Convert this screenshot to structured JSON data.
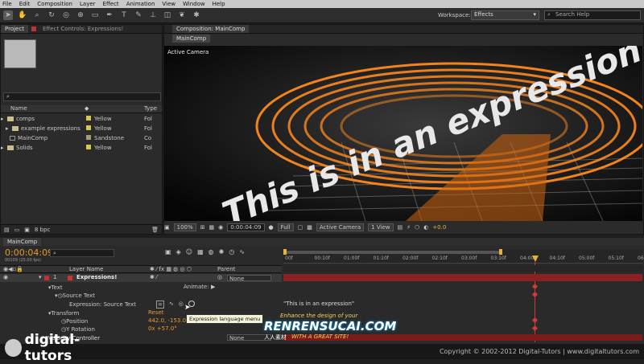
{
  "menu": [
    "File",
    "Edit",
    "Composition",
    "Layer",
    "Effect",
    "Animation",
    "View",
    "Window",
    "Help"
  ],
  "workspace": {
    "label": "Workspace:",
    "value": "Effects"
  },
  "search_help_placeholder": "Search Help",
  "project_panel": {
    "tabs": [
      "Project",
      "Effect Controls: Expressions!"
    ],
    "columns": {
      "name": "Name",
      "type": "Type"
    },
    "items": [
      {
        "name": "comps",
        "label": "Yellow",
        "label_color": "#d8c84a",
        "type": "Fol"
      },
      {
        "name": "example expressions",
        "label": "Yellow",
        "label_color": "#d8c84a",
        "type": "Fol"
      },
      {
        "name": "MainComp",
        "label": "Sandstone",
        "label_color": "#a89a7a",
        "type": "Co"
      },
      {
        "name": "Solids",
        "label": "Yellow",
        "label_color": "#d8c84a",
        "type": "Fol"
      }
    ],
    "bpc": "8 bpc"
  },
  "composition": {
    "tab": "Composition: MainComp",
    "subtab": "MainComp",
    "camera_label": "Active Camera",
    "scene_text": "This is in an expression",
    "zoom": "100%",
    "timecode": "0:00:04:09",
    "resolution": "Full",
    "camera_select": "Active Camera",
    "views": "1 View",
    "exposure": "+0.0"
  },
  "timeline": {
    "tab": "MainComp",
    "timecode": "0:00:04:09",
    "frame_info": "00109 (25.00 fps)",
    "col_layer_name": "Layer Name",
    "col_parent": "Parent",
    "ruler_ticks": [
      "00f",
      "00:10f",
      "01:00f",
      "01:10f",
      "02:00f",
      "02:10f",
      "03:00f",
      "03:10f",
      "04:00f",
      "04:10f",
      "05:00f",
      "05:10f",
      "06:00f"
    ],
    "layer": {
      "number": "1",
      "name": "Expressions!",
      "parent": "None"
    },
    "rows": [
      {
        "label": "Text",
        "indent": 1
      },
      {
        "label": "Source Text",
        "indent": 2
      },
      {
        "label": "Expression: Source Text",
        "indent": 3
      },
      {
        "label": "Transform",
        "indent": 1
      },
      {
        "label": "Position",
        "indent": 2
      },
      {
        "label": "Y Rotation",
        "indent": 2
      },
      {
        "label": "Velocity Controller",
        "indent": 1
      }
    ],
    "animate_label": "Animate:",
    "reset_label": "Reset",
    "position_value": "442.0, -153.0",
    "rotation_value": "0x +57.0°",
    "expression_text": "\"This is in an expression\"",
    "tooltip": "Expression language menu",
    "parent2": "None"
  },
  "watermark": {
    "brand": "digital-tutors",
    "copyright": "Copyright © 2002-2012 Digital-Tutors  |  www.digitaltutors.com",
    "site_tagline": "Enhance the design of your",
    "site_name": "RENRENSUCAI.COM",
    "site_cn": "人人素材",
    "site_slogan": "WITH A GREAT SITE!"
  }
}
